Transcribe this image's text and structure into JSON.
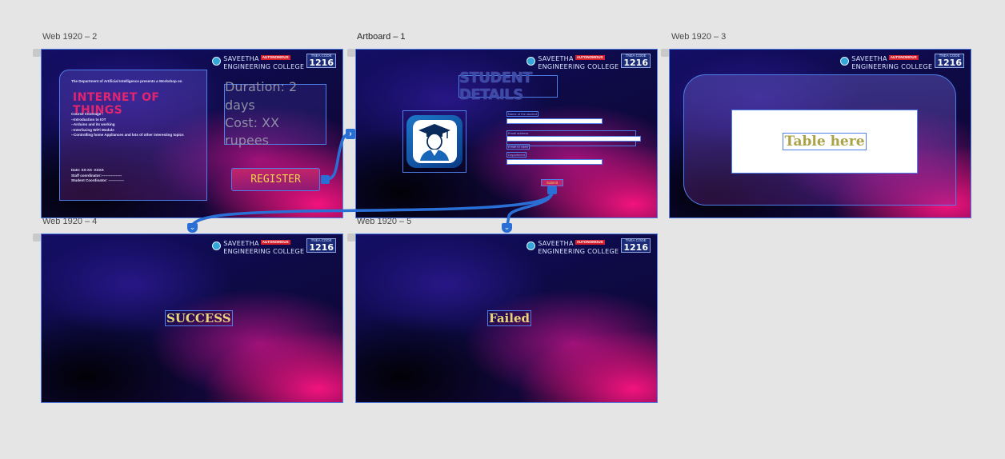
{
  "artboards": [
    {
      "id": "web-1920-2",
      "label": "Web 1920 – 2"
    },
    {
      "id": "artboard-1",
      "label": "Artboard – 1"
    },
    {
      "id": "web-1920-3",
      "label": "Web 1920 – 3"
    },
    {
      "id": "web-1920-4",
      "label": "Web 1920 – 4"
    },
    {
      "id": "web-1920-5",
      "label": "Web 1920 – 5"
    }
  ],
  "logo": {
    "name": "SAVEETHA",
    "college": "ENGINEERING COLLEGE",
    "badge": "AUTONOMOUS",
    "code_label": "TNEA CODE",
    "code": "1216"
  },
  "workshop": {
    "intro": "The Department of Artificial Intelligence presents a Workshop on",
    "title": "INTERNET OF THINGS",
    "coverage_heading": "Course Coverage :",
    "coverage": [
      "--Introduction to IOT",
      "--Arduino and its working",
      "--Interfacing WiFi Module",
      "--Controlling home Appliances and lots of other interesting topics"
    ],
    "date": "Date: XX-XX -XXXX",
    "staff": "Staff coordinator:-----------------",
    "student": "Student Coordinator: -------------",
    "duration": "Duration: 2 days",
    "cost": "Cost: XX rupees",
    "register": "REGISTER"
  },
  "student_form": {
    "title": "STUDENT DETAILS",
    "fields": [
      {
        "label": "Name of the student"
      },
      {
        "label": "Email address"
      },
      {
        "label": "Email ID used"
      },
      {
        "label": "Department"
      }
    ],
    "submit": "Submit"
  },
  "table": {
    "placeholder": "Table here"
  },
  "success": {
    "text": "SUCCESS"
  },
  "failed": {
    "text": "Failed"
  },
  "colors": {
    "canvas": "#e5e5e5",
    "selection": "#4e7fe8",
    "prototype_wire": "#2a6fd6",
    "accent_pink": "#e3246f",
    "accent_yellow": "#f2d34a"
  }
}
